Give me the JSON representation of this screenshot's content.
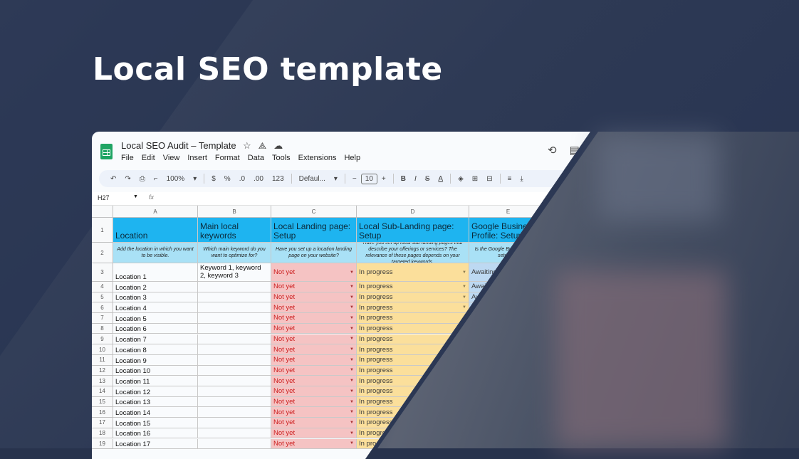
{
  "hero": {
    "title": "Local SEO template"
  },
  "sheet": {
    "doc_title": "Local SEO Audit – Template",
    "title_icons": [
      "star-icon",
      "move-to-drive-icon",
      "cloud-status-icon"
    ],
    "menu": [
      "File",
      "Edit",
      "View",
      "Insert",
      "Format",
      "Data",
      "Tools",
      "Extensions",
      "Help"
    ],
    "toolbar": {
      "zoom": "100%",
      "currency": "$",
      "percent": "%",
      "decrease_decimal": ".0",
      "increase_decimal": ".00",
      "number_format": "123",
      "font": "Defaul...",
      "font_size": "10",
      "bold": "B",
      "italic": "I",
      "strike": "S",
      "text_color": "A"
    },
    "namebox": "H27",
    "fx": "fx",
    "columns": [
      "A",
      "B",
      "C",
      "D",
      "E"
    ],
    "header_row": [
      "Location",
      "Main local keywords",
      "Local Landing page: Setup",
      "Local Sub-Landing page: Setup",
      "Google Business Profile: Setup"
    ],
    "desc_row": [
      "Add the location in which you want to be visible.",
      "Which main keyword do you want to optimize for?",
      "Have you set up a location landing page on your website?",
      "Have you set up local sub-landing pages that describe your offerings or services? The relevance of these pages depends on your targeted keywords.",
      "Is the Google Business Profile setup a..."
    ],
    "row_numbers": [
      "1",
      "2",
      "3",
      "4",
      "5",
      "6",
      "7",
      "8",
      "9",
      "10",
      "11",
      "12",
      "13",
      "14",
      "15",
      "16",
      "17",
      "18",
      "19"
    ],
    "rows": [
      {
        "location": "Location 1",
        "keywords": "Keyword 1, keyword 2, keyword 3",
        "landing": "Not yet",
        "sub": "In progress",
        "gbp": "Awaiting"
      },
      {
        "location": "Location 2",
        "keywords": "",
        "landing": "Not yet",
        "sub": "In progress",
        "gbp": "Awai"
      },
      {
        "location": "Location 3",
        "keywords": "",
        "landing": "Not yet",
        "sub": "In progress",
        "gbp": "Aw"
      },
      {
        "location": "Location 4",
        "keywords": "",
        "landing": "Not yet",
        "sub": "In progress",
        "gbp": ""
      },
      {
        "location": "Location 5",
        "keywords": "",
        "landing": "Not yet",
        "sub": "In progress",
        "gbp": ""
      },
      {
        "location": "Location 6",
        "keywords": "",
        "landing": "Not yet",
        "sub": "In progress",
        "gbp": ""
      },
      {
        "location": "Location 7",
        "keywords": "",
        "landing": "Not yet",
        "sub": "In progress",
        "gbp": ""
      },
      {
        "location": "Location 8",
        "keywords": "",
        "landing": "Not yet",
        "sub": "In progress",
        "gbp": ""
      },
      {
        "location": "Location 9",
        "keywords": "",
        "landing": "Not yet",
        "sub": "In progress",
        "gbp": ""
      },
      {
        "location": "Location 10",
        "keywords": "",
        "landing": "Not yet",
        "sub": "In progress",
        "gbp": ""
      },
      {
        "location": "Location 11",
        "keywords": "",
        "landing": "Not yet",
        "sub": "In progress",
        "gbp": ""
      },
      {
        "location": "Location 12",
        "keywords": "",
        "landing": "Not yet",
        "sub": "In progress",
        "gbp": ""
      },
      {
        "location": "Location 13",
        "keywords": "",
        "landing": "Not yet",
        "sub": "In progress",
        "gbp": ""
      },
      {
        "location": "Location 14",
        "keywords": "",
        "landing": "Not yet",
        "sub": "In progress",
        "gbp": ""
      },
      {
        "location": "Location 15",
        "keywords": "",
        "landing": "Not yet",
        "sub": "In progress",
        "gbp": ""
      },
      {
        "location": "Location 16",
        "keywords": "",
        "landing": "Not yet",
        "sub": "In progress",
        "gbp": ""
      },
      {
        "location": "Location 17",
        "keywords": "",
        "landing": "Not yet",
        "sub": "In progress",
        "gbp": ""
      }
    ],
    "colors": {
      "header": "#1eb4f0",
      "description": "#a9e1f6",
      "not_yet": "#f5c3c3",
      "in_progress": "#fbdf9b",
      "awaiting": "#bdd9f2"
    }
  }
}
